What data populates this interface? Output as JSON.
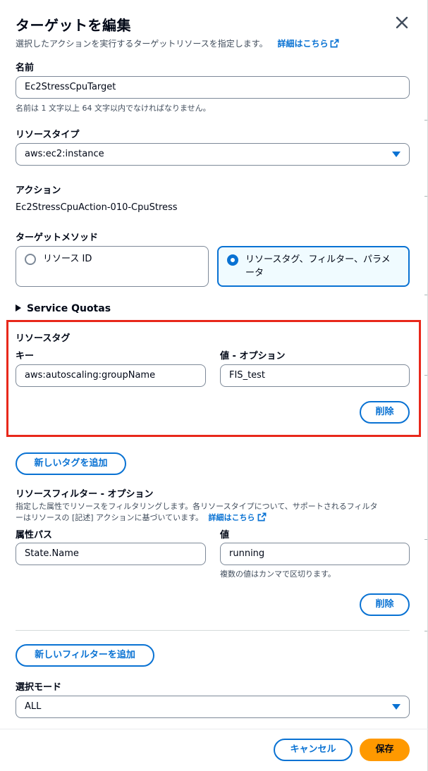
{
  "header": {
    "title": "ターゲットを編集",
    "description": "選択したアクションを実行するターゲットリソースを指定します。",
    "learn_more": "詳細はこちら"
  },
  "name_field": {
    "label": "名前",
    "value": "Ec2StressCpuTarget",
    "hint": "名前は 1 文字以上 64 文字以内でなければなりません。"
  },
  "resource_type": {
    "label": "リソースタイプ",
    "value": "aws:ec2:instance"
  },
  "action": {
    "label": "アクション",
    "value": "Ec2StressCpuAction-010-CpuStress"
  },
  "target_method": {
    "label": "ターゲットメソッド",
    "options": [
      {
        "label": "リソース ID",
        "selected": false
      },
      {
        "label": "リソースタグ、フィルター、パラメーター",
        "line1": "リソースタグ、フィルター、パラメ",
        "line2": "ータ",
        "selected": true
      }
    ]
  },
  "service_quotas": {
    "label": "Service Quotas"
  },
  "resource_tags": {
    "label": "リソースタグ",
    "key_label": "キー",
    "value_label": "値 - オプション",
    "key_value": "aws:autoscaling:groupName",
    "value_value": "FIS_test",
    "remove_label": "削除"
  },
  "add_tag_button": "新しいタグを追加",
  "resource_filter": {
    "label": "リソースフィルター - オプション",
    "description_line1": "指定した属性でリソースをフィルタリングします。各リソースタイプについて、サポートされるフィルタ",
    "description_line2": "ーはリソースの [記述] アクションに基づいています。",
    "learn_more": "詳細はこちら",
    "path_label": "属性パス",
    "value_label": "値",
    "path_value": "State.Name",
    "value_value": "running",
    "value_hint": "複数の値はカンマで区切ります。",
    "remove_label": "削除"
  },
  "add_filter_button": "新しいフィルターを追加",
  "selection_mode": {
    "label": "選択モード",
    "value": "ALL"
  },
  "footer": {
    "cancel_label": "キャンセル",
    "save_label": "保存"
  },
  "colors": {
    "accent": "#0972d3",
    "primary_button": "#ff9900",
    "highlight_box": "#e8281b"
  }
}
